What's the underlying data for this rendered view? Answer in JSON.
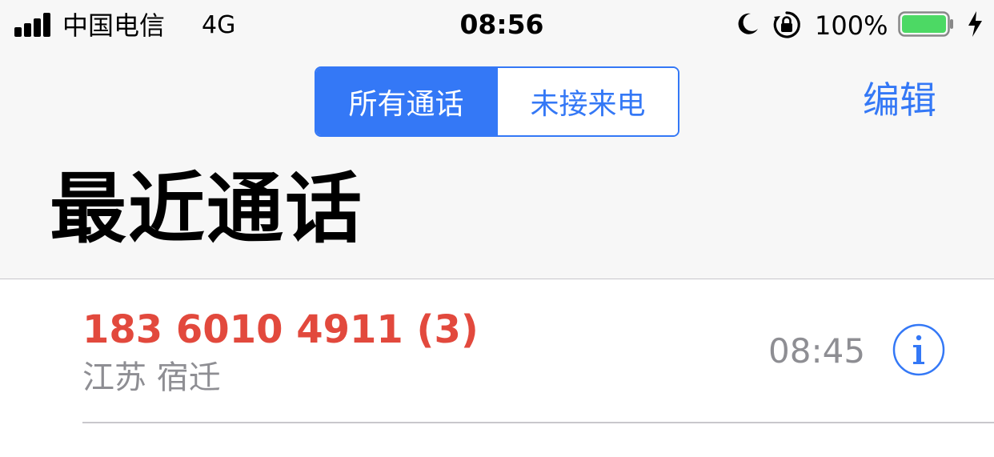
{
  "status_bar": {
    "carrier": "中国电信",
    "network": "4G",
    "time": "08:56",
    "battery_percent": "100%",
    "battery_level": 1.0,
    "icons": [
      "signal-icon",
      "moon-icon",
      "rotation-lock-icon",
      "battery-icon",
      "charging-icon"
    ]
  },
  "nav": {
    "segments": [
      "所有通话",
      "未接来电"
    ],
    "active_segment": 0,
    "edit_label": "编辑"
  },
  "title": "最近通话",
  "calls": [
    {
      "number": "183 6010 4911 (3)",
      "location": "江苏 宿迁",
      "time": "08:45",
      "missed": true,
      "info_icon": "info-icon"
    },
    {
      "number": "",
      "location": "",
      "time": "",
      "missed": false
    }
  ],
  "colors": {
    "accent": "#3478f6",
    "missed": "#e2493d",
    "secondary_text": "#8e8e93",
    "battery": "#4cd964"
  }
}
